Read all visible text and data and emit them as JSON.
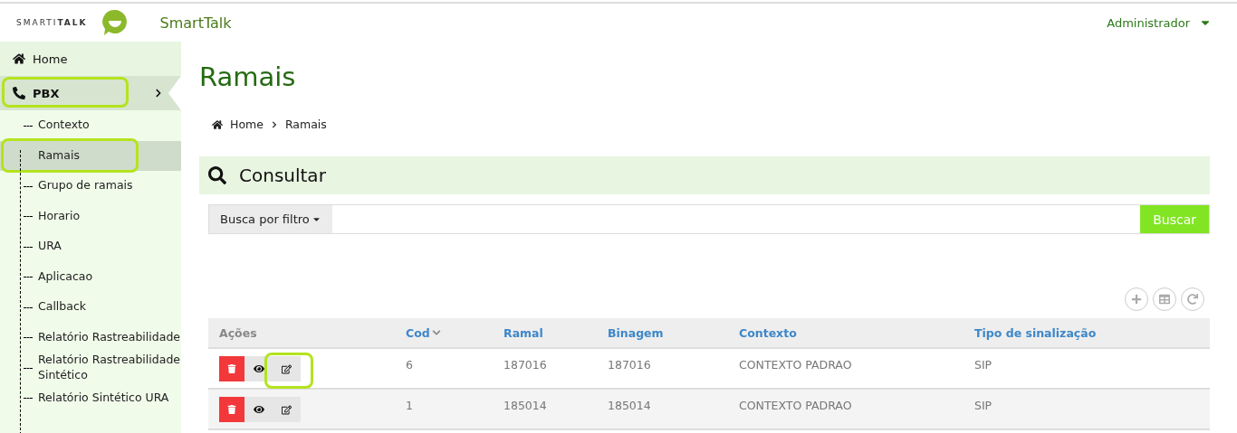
{
  "header": {
    "logo_text": "SMARTI**TALK**",
    "app_name": "SmartTalk",
    "user_menu": "Administrador"
  },
  "sidebar": {
    "items": [
      {
        "label": "Home",
        "kind": "home",
        "selected": false
      },
      {
        "label": "PBX",
        "kind": "phone",
        "selected": true,
        "highlighted": true,
        "children": [
          {
            "label": "Contexto",
            "selected": false,
            "highlighted": false
          },
          {
            "label": "Ramais",
            "selected": true,
            "highlighted": true
          },
          {
            "label": "Grupo de ramais",
            "selected": false,
            "highlighted": false
          },
          {
            "label": "Horario",
            "selected": false,
            "highlighted": false
          },
          {
            "label": "URA",
            "selected": false,
            "highlighted": false
          },
          {
            "label": "Aplicacao",
            "selected": false,
            "highlighted": false
          },
          {
            "label": "Callback",
            "selected": false,
            "highlighted": false
          },
          {
            "label": "Relatório Rastreabilidade",
            "selected": false,
            "highlighted": false
          },
          {
            "label": "Relatório Rastreabilidade Sintético",
            "selected": false,
            "highlighted": false
          },
          {
            "label": "Relatório Sintético URA",
            "selected": false,
            "highlighted": false
          }
        ]
      }
    ]
  },
  "page": {
    "title": "Ramais",
    "breadcrumb": [
      "Home",
      "Ramais"
    ]
  },
  "search_panel": {
    "title": "Consultar",
    "filter_button": "Busca por filtro",
    "search_button": "Buscar"
  },
  "table": {
    "columns": [
      {
        "label": "Ações",
        "kind": "plain"
      },
      {
        "label": "Cod",
        "kind": "sorted"
      },
      {
        "label": "Ramal",
        "kind": "link"
      },
      {
        "label": "Binagem",
        "kind": "link"
      },
      {
        "label": "Contexto",
        "kind": "link"
      },
      {
        "label": "Tipo de sinalização",
        "kind": "link"
      }
    ],
    "rows": [
      {
        "edit_highlighted": true,
        "cells": [
          "",
          "6",
          "187016",
          "187016",
          "CONTEXTO PADRAO",
          "SIP"
        ]
      },
      {
        "edit_highlighted": false,
        "cells": [
          "",
          "1",
          "185014",
          "185014",
          "CONTEXTO PADRAO",
          "SIP"
        ]
      }
    ]
  }
}
